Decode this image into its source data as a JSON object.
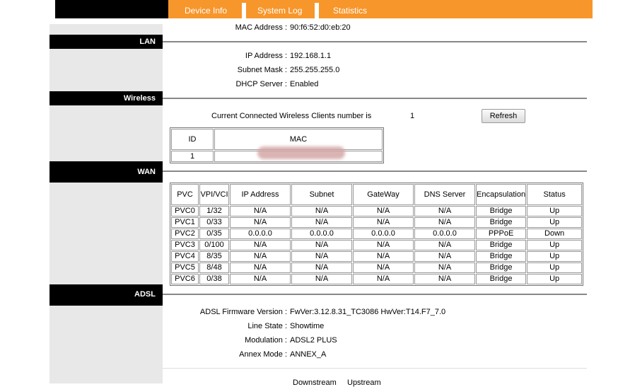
{
  "tabs": [
    "Device Info",
    "System Log",
    "Statistics"
  ],
  "top": {
    "mac_label": "MAC Address :",
    "mac_value": "90:f6:52:d0:eb:20"
  },
  "sections": {
    "lan": "LAN",
    "wireless": "Wireless",
    "wan": "WAN",
    "adsl": "ADSL"
  },
  "lan": {
    "ip_label": "IP Address :",
    "ip_value": "192.168.1.1",
    "mask_label": "Subnet Mask :",
    "mask_value": "255.255.255.0",
    "dhcp_label": "DHCP Server :",
    "dhcp_value": "Enabled"
  },
  "wireless": {
    "clients_label": "Current Connected Wireless Clients number is",
    "clients_value": "1",
    "refresh_label": "Refresh",
    "table_headers": [
      "ID",
      "MAC"
    ],
    "rows": [
      {
        "id": "1",
        "mac": ""
      }
    ]
  },
  "wan": {
    "headers": [
      "PVC",
      "VPI/VCI",
      "IP Address",
      "Subnet",
      "GateWay",
      "DNS Server",
      "Encapsulation",
      "Status"
    ],
    "rows": [
      [
        "PVC0",
        "1/32",
        "N/A",
        "N/A",
        "N/A",
        "N/A",
        "Bridge",
        "Up"
      ],
      [
        "PVC1",
        "0/33",
        "N/A",
        "N/A",
        "N/A",
        "N/A",
        "Bridge",
        "Up"
      ],
      [
        "PVC2",
        "0/35",
        "0.0.0.0",
        "0.0.0.0",
        "0.0.0.0",
        "0.0.0.0",
        "PPPoE",
        "Down"
      ],
      [
        "PVC3",
        "0/100",
        "N/A",
        "N/A",
        "N/A",
        "N/A",
        "Bridge",
        "Up"
      ],
      [
        "PVC4",
        "8/35",
        "N/A",
        "N/A",
        "N/A",
        "N/A",
        "Bridge",
        "Up"
      ],
      [
        "PVC5",
        "8/48",
        "N/A",
        "N/A",
        "N/A",
        "N/A",
        "Bridge",
        "Up"
      ],
      [
        "PVC6",
        "0/38",
        "N/A",
        "N/A",
        "N/A",
        "N/A",
        "Bridge",
        "Up"
      ]
    ]
  },
  "adsl": {
    "fw_label": "ADSL Firmware Version :",
    "fw_value": "FwVer:3.12.8.31_TC3086 HwVer:T14.F7_7.0",
    "line_label": "Line State :",
    "line_value": "Showtime",
    "mod_label": "Modulation :",
    "mod_value": "ADSL2 PLUS",
    "annex_label": "Annex Mode :",
    "annex_value": "ANNEX_A",
    "downstream": "Downstream",
    "upstream": "Upstream"
  },
  "colors": {
    "orange": "#f7962b",
    "grey": "#e8e8e8",
    "header": "#000000"
  }
}
